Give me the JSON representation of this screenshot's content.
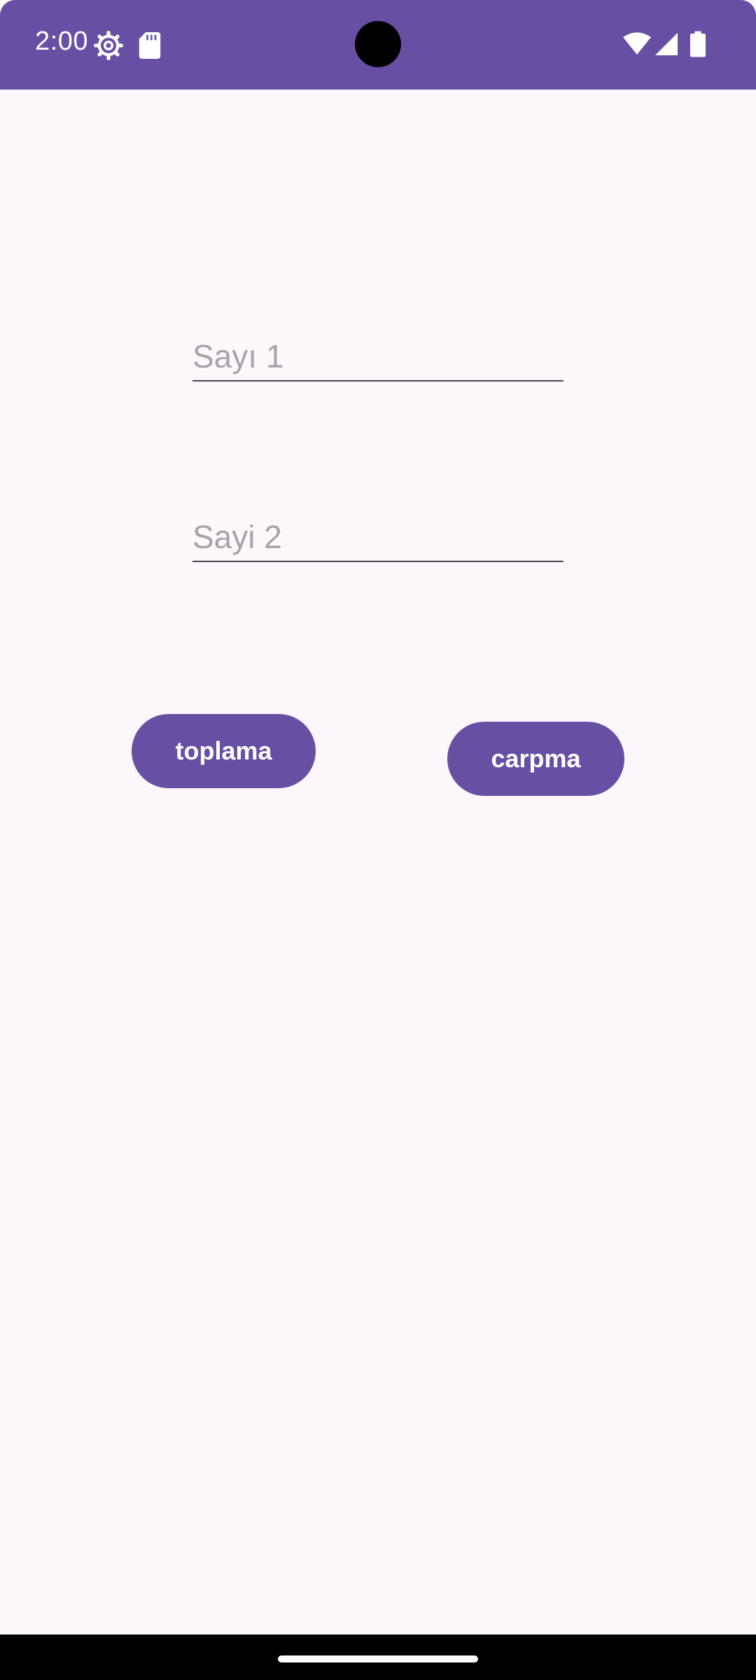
{
  "status_bar": {
    "time": "2:00",
    "background_color": "#6750A4",
    "left_icons": [
      "gear-icon",
      "sdcard-icon"
    ],
    "right_icons": [
      "wifi-icon",
      "signal-icon",
      "battery-icon"
    ]
  },
  "form": {
    "number1": {
      "value": "",
      "placeholder": "Sayı 1"
    },
    "number2": {
      "value": "",
      "placeholder": "Sayi 2"
    }
  },
  "buttons": {
    "add_label": "toplama",
    "multiply_label": "carpma",
    "color": "#6750A4"
  },
  "nav_bar": {
    "handle": "home-handle"
  }
}
